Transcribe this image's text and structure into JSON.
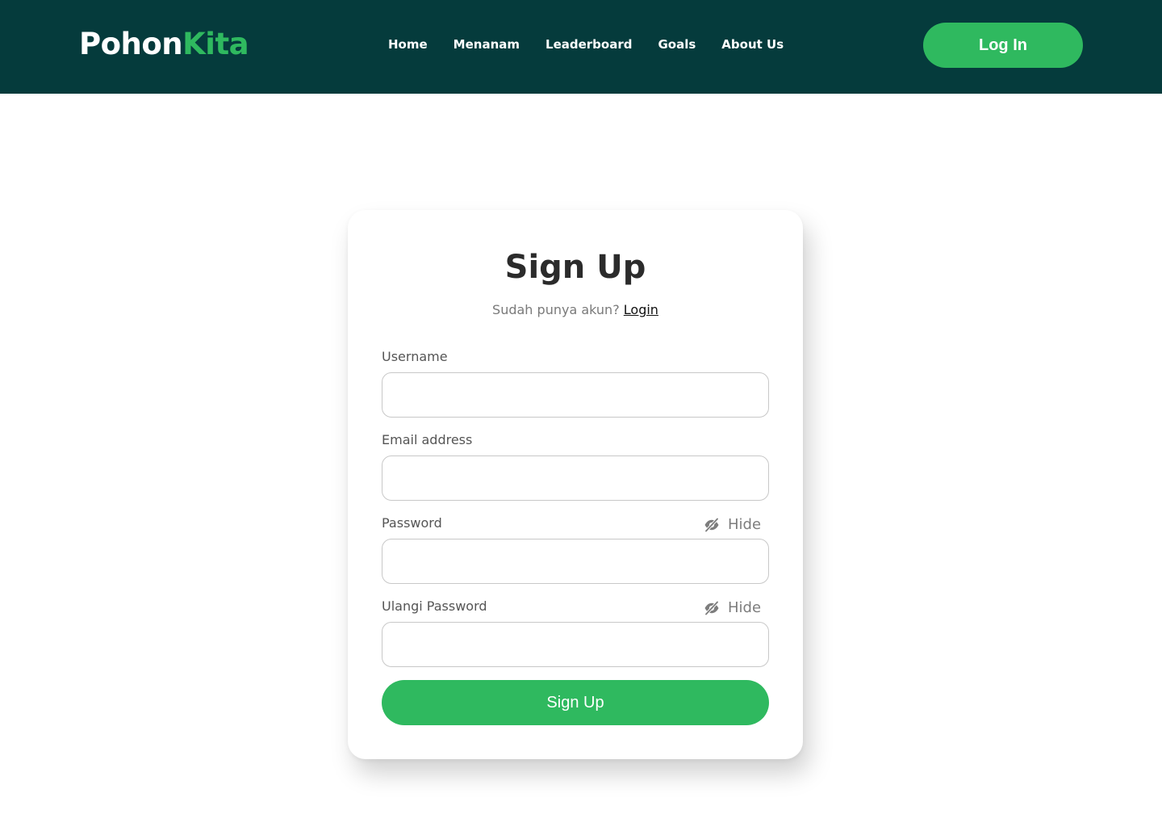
{
  "header": {
    "brand_part1": "Pohon",
    "brand_part2": "Kita",
    "nav": [
      "Home",
      "Menanam",
      "Leaderboard",
      "Goals",
      "About Us"
    ],
    "login_button": "Log In"
  },
  "form": {
    "title": "Sign Up",
    "subtitle_prefix": "Sudah punya akun?",
    "subtitle_link": "Login",
    "fields": {
      "username": {
        "label": "Username",
        "value": ""
      },
      "email": {
        "label": "Email address",
        "value": ""
      },
      "password": {
        "label": "Password",
        "value": "",
        "toggle_label": "Hide",
        "toggle_icon": "eye-slash-icon"
      },
      "confirm_password": {
        "label": "Ulangi Password",
        "value": "",
        "toggle_label": "Hide",
        "toggle_icon": "eye-slash-icon"
      }
    },
    "submit_label": "Sign Up"
  },
  "colors": {
    "navbar_bg": "#053b3c",
    "accent_green": "#2fb95f",
    "page_bg": "#ffffff"
  }
}
